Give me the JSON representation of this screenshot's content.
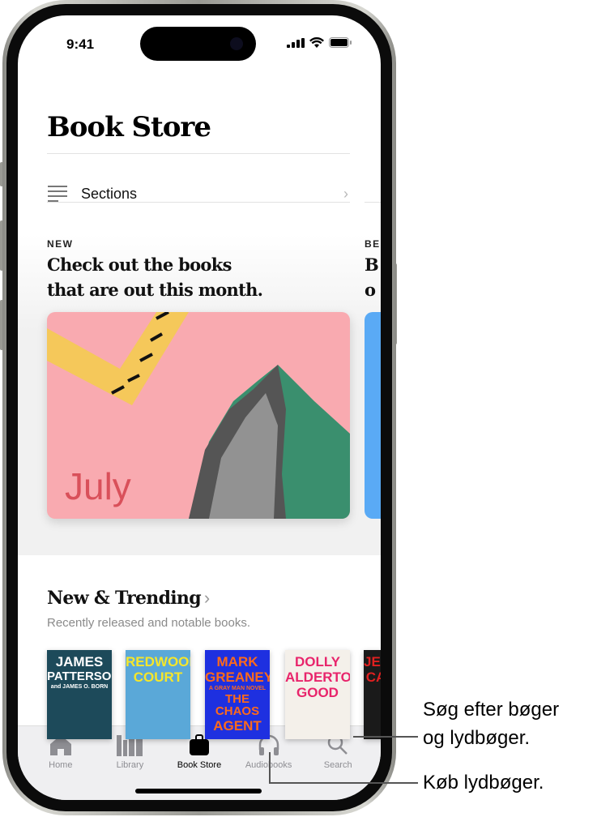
{
  "status_bar": {
    "time": "9:41"
  },
  "header": {
    "title": "Book Store"
  },
  "sections_row": {
    "label": "Sections",
    "icon": "list-icon"
  },
  "featured": [
    {
      "kicker": "NEW",
      "headline_line1": "Check out the books",
      "headline_line2": "that are out this month.",
      "card_text": "July"
    },
    {
      "kicker": "BE",
      "headline_line1": "B",
      "headline_line2": "o"
    }
  ],
  "new_trending": {
    "title": "New & Trending",
    "subtitle": "Recently released and notable books.",
    "books": [
      {
        "lines": [
          "JAMES",
          "PATTERSON",
          "and JAMES O. BORN"
        ],
        "bg": "#1d4a5a",
        "fg": "#ffffff"
      },
      {
        "lines": [
          "REDWOOD",
          "COURT"
        ],
        "bg": "#5aa8d8",
        "fg": "#f5e62a"
      },
      {
        "lines": [
          "MARK",
          "GREANEY",
          "A GRAY MAN NOVEL",
          "THE CHAOS",
          "AGENT"
        ],
        "bg": "#1e30e0",
        "fg": "#ff6a1a"
      },
      {
        "lines": [
          "DOLLY",
          "ALDERTON",
          "GOOD"
        ],
        "bg": "#f4f0ea",
        "fg": "#e8246b"
      },
      {
        "lines": [
          "JEN",
          "CA"
        ],
        "bg": "#1a1a1a",
        "fg": "#e02020"
      }
    ]
  },
  "tabbar": {
    "tabs": [
      {
        "label": "Home",
        "icon": "home-icon"
      },
      {
        "label": "Library",
        "icon": "library-icon"
      },
      {
        "label": "Book Store",
        "icon": "bag-icon",
        "active": true
      },
      {
        "label": "Audiobooks",
        "icon": "headphones-icon"
      },
      {
        "label": "Search",
        "icon": "search-icon"
      }
    ]
  },
  "callouts": {
    "search_line1": "Søg efter bøger",
    "search_line2": "og lydbøger.",
    "audiobooks": "Køb lydbøger."
  },
  "colors": {
    "card_pink": "#f9aab0",
    "card_green": "#3a8f6e",
    "card_yellow": "#f5c85a",
    "july_red": "#d9505a"
  }
}
